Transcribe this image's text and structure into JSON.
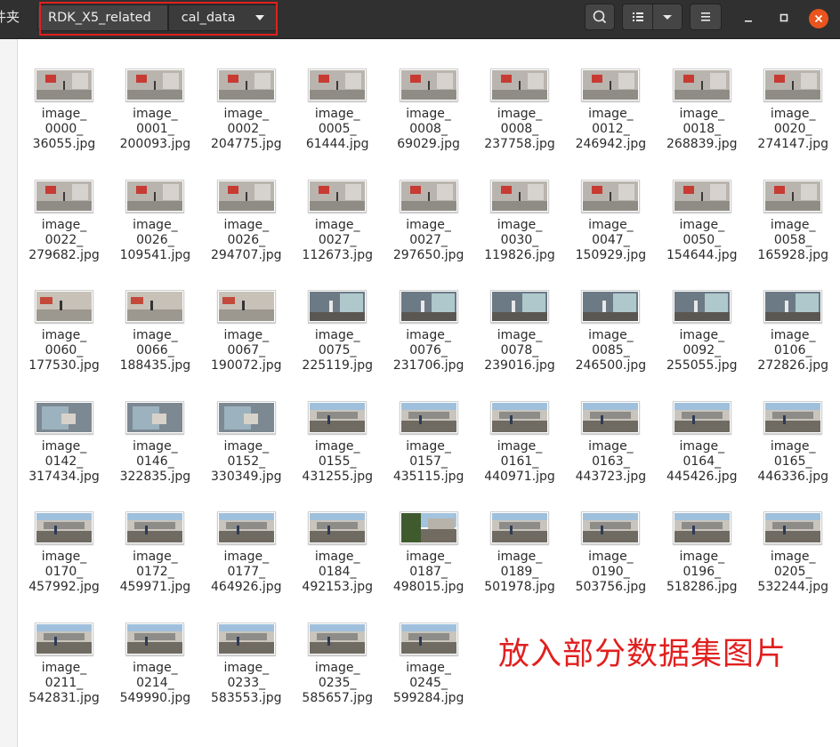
{
  "window": {
    "sidebar_stub_label": "件夹"
  },
  "breadcrumbs": [
    {
      "label": "RDK_X5_related"
    },
    {
      "label": "cal_data"
    }
  ],
  "icons": {
    "search": "search-icon",
    "view_list": "list-view-icon",
    "view_options": "chevron-down-icon",
    "menu": "hamburger-menu-icon",
    "minimize": "minimize-icon",
    "maximize": "maximize-icon",
    "close": "close-icon"
  },
  "colors": {
    "highlight": "#e0201f",
    "close_button": "#e9541f",
    "headerbar": "#303030"
  },
  "files": [
    {
      "name": "image_\n0000_\n36055.jpg",
      "scene": "indoor"
    },
    {
      "name": "image_\n0001_\n200093.jpg",
      "scene": "indoor"
    },
    {
      "name": "image_\n0002_\n204775.jpg",
      "scene": "indoor"
    },
    {
      "name": "image_\n0005_\n61444.jpg",
      "scene": "indoor"
    },
    {
      "name": "image_\n0008_\n69029.jpg",
      "scene": "indoor"
    },
    {
      "name": "image_\n0008_\n237758.jpg",
      "scene": "indoor"
    },
    {
      "name": "image_\n0012_\n246942.jpg",
      "scene": "indoor"
    },
    {
      "name": "image_\n0018_\n268839.jpg",
      "scene": "indoor"
    },
    {
      "name": "image_\n0020_\n274147.jpg",
      "scene": "indoor"
    },
    {
      "name": "image_\n0022_\n279682.jpg",
      "scene": "indoor"
    },
    {
      "name": "image_\n0026_\n109541.jpg",
      "scene": "indoor"
    },
    {
      "name": "image_\n0026_\n294707.jpg",
      "scene": "indoor"
    },
    {
      "name": "image_\n0027_\n112673.jpg",
      "scene": "indoor"
    },
    {
      "name": "image_\n0027_\n297650.jpg",
      "scene": "indoor"
    },
    {
      "name": "image_\n0030_\n119826.jpg",
      "scene": "indoor"
    },
    {
      "name": "image_\n0047_\n150929.jpg",
      "scene": "indoor"
    },
    {
      "name": "image_\n0050_\n154644.jpg",
      "scene": "indoor"
    },
    {
      "name": "image_\n0058_\n165928.jpg",
      "scene": "indoor"
    },
    {
      "name": "image_\n0060_\n177530.jpg",
      "scene": "hall"
    },
    {
      "name": "image_\n0066_\n188435.jpg",
      "scene": "hall"
    },
    {
      "name": "image_\n0067_\n190072.jpg",
      "scene": "hall"
    },
    {
      "name": "image_\n0075_\n225119.jpg",
      "scene": "glass"
    },
    {
      "name": "image_\n0076_\n231706.jpg",
      "scene": "glass"
    },
    {
      "name": "image_\n0078_\n239016.jpg",
      "scene": "glass"
    },
    {
      "name": "image_\n0085_\n246500.jpg",
      "scene": "glass"
    },
    {
      "name": "image_\n0092_\n255055.jpg",
      "scene": "glass"
    },
    {
      "name": "image_\n0106_\n272826.jpg",
      "scene": "glass"
    },
    {
      "name": "image_\n0142_\n317434.jpg",
      "scene": "close"
    },
    {
      "name": "image_\n0146_\n322835.jpg",
      "scene": "close"
    },
    {
      "name": "image_\n0152_\n330349.jpg",
      "scene": "close"
    },
    {
      "name": "image_\n0155_\n431255.jpg",
      "scene": "outdoor"
    },
    {
      "name": "image_\n0157_\n435115.jpg",
      "scene": "outdoor"
    },
    {
      "name": "image_\n0161_\n440971.jpg",
      "scene": "outdoor"
    },
    {
      "name": "image_\n0163_\n443723.jpg",
      "scene": "outdoor"
    },
    {
      "name": "image_\n0164_\n445426.jpg",
      "scene": "outdoor"
    },
    {
      "name": "image_\n0165_\n446336.jpg",
      "scene": "outdoor"
    },
    {
      "name": "image_\n0170_\n457992.jpg",
      "scene": "outdoor"
    },
    {
      "name": "image_\n0172_\n459971.jpg",
      "scene": "outdoor"
    },
    {
      "name": "image_\n0177_\n464926.jpg",
      "scene": "outdoor"
    },
    {
      "name": "image_\n0184_\n492153.jpg",
      "scene": "outdoor"
    },
    {
      "name": "image_\n0187_\n498015.jpg",
      "scene": "tree"
    },
    {
      "name": "image_\n0189_\n501978.jpg",
      "scene": "outdoor"
    },
    {
      "name": "image_\n0190_\n503756.jpg",
      "scene": "outdoor"
    },
    {
      "name": "image_\n0196_\n518286.jpg",
      "scene": "outdoor"
    },
    {
      "name": "image_\n0205_\n532244.jpg",
      "scene": "outdoor"
    },
    {
      "name": "image_\n0211_\n542831.jpg",
      "scene": "outdoor"
    },
    {
      "name": "image_\n0214_\n549990.jpg",
      "scene": "outdoor"
    },
    {
      "name": "image_\n0233_\n583553.jpg",
      "scene": "outdoor"
    },
    {
      "name": "image_\n0235_\n585657.jpg",
      "scene": "outdoor"
    },
    {
      "name": "image_\n0245_\n599284.jpg",
      "scene": "outdoor"
    }
  ],
  "annotation": {
    "text": "放入部分数据集图片"
  }
}
